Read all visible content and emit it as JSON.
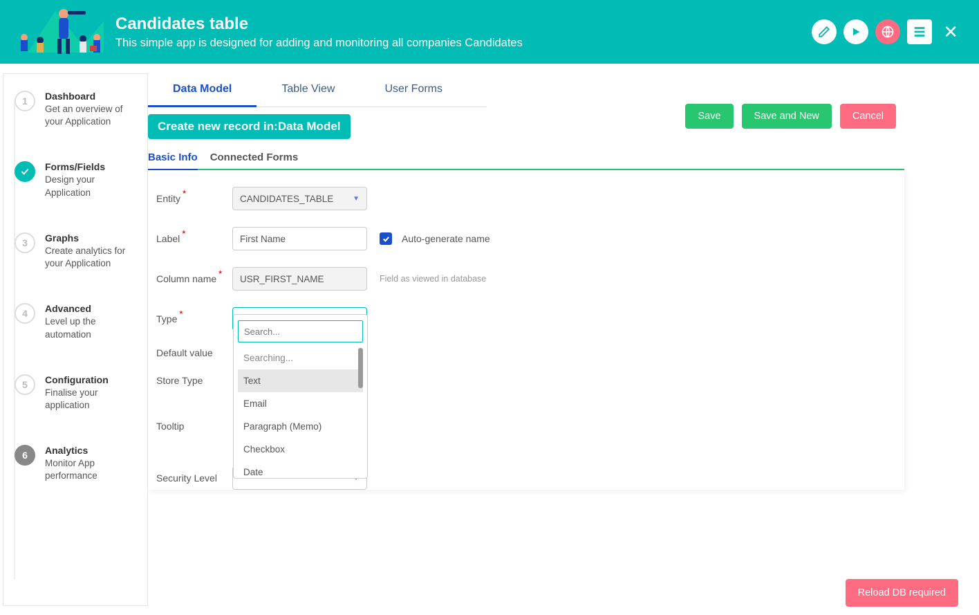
{
  "header": {
    "title": "Candidates table",
    "subtitle": "This simple app is designed for adding and monitoring all companies Candidates"
  },
  "sidebar": {
    "steps": [
      {
        "num": "1",
        "title": "Dashboard",
        "desc": "Get an overview of your Application"
      },
      {
        "num": "✓",
        "title": "Forms/Fields",
        "desc": "Design your Application",
        "active": true
      },
      {
        "num": "3",
        "title": "Graphs",
        "desc": "Create analytics for your Application"
      },
      {
        "num": "4",
        "title": "Advanced",
        "desc": "Level up the automation"
      },
      {
        "num": "5",
        "title": "Configuration",
        "desc": "Finalise your application"
      },
      {
        "num": "6",
        "title": "Analytics",
        "desc": "Monitor App performance"
      }
    ]
  },
  "tabs": {
    "data_model": "Data Model",
    "table_view": "Table View",
    "user_forms": "User Forms"
  },
  "pill": "Create new record in:Data Model",
  "actions": {
    "save": "Save",
    "save_new": "Save and New",
    "cancel": "Cancel"
  },
  "inner_tabs": {
    "basic": "Basic Info",
    "connected": "Connected Forms"
  },
  "form": {
    "entity_label": "Entity",
    "entity_value": "CANDIDATES_TABLE",
    "label_label": "Label",
    "label_value": "First Name",
    "auto_gen": "Auto-generate name",
    "column_label": "Column name",
    "column_value": "USR_FIRST_NAME",
    "column_hint": "Field as viewed in database",
    "type_label": "Type",
    "default_label": "Default value",
    "store_label": "Store Type",
    "tooltip_label": "Tooltip",
    "security_label": "Security Level"
  },
  "dropdown": {
    "search_placeholder": "Search...",
    "searching": "Searching...",
    "options": [
      "Text",
      "Email",
      "Paragraph (Memo)",
      "Checkbox",
      "Date"
    ]
  },
  "reload": "Reload DB required"
}
